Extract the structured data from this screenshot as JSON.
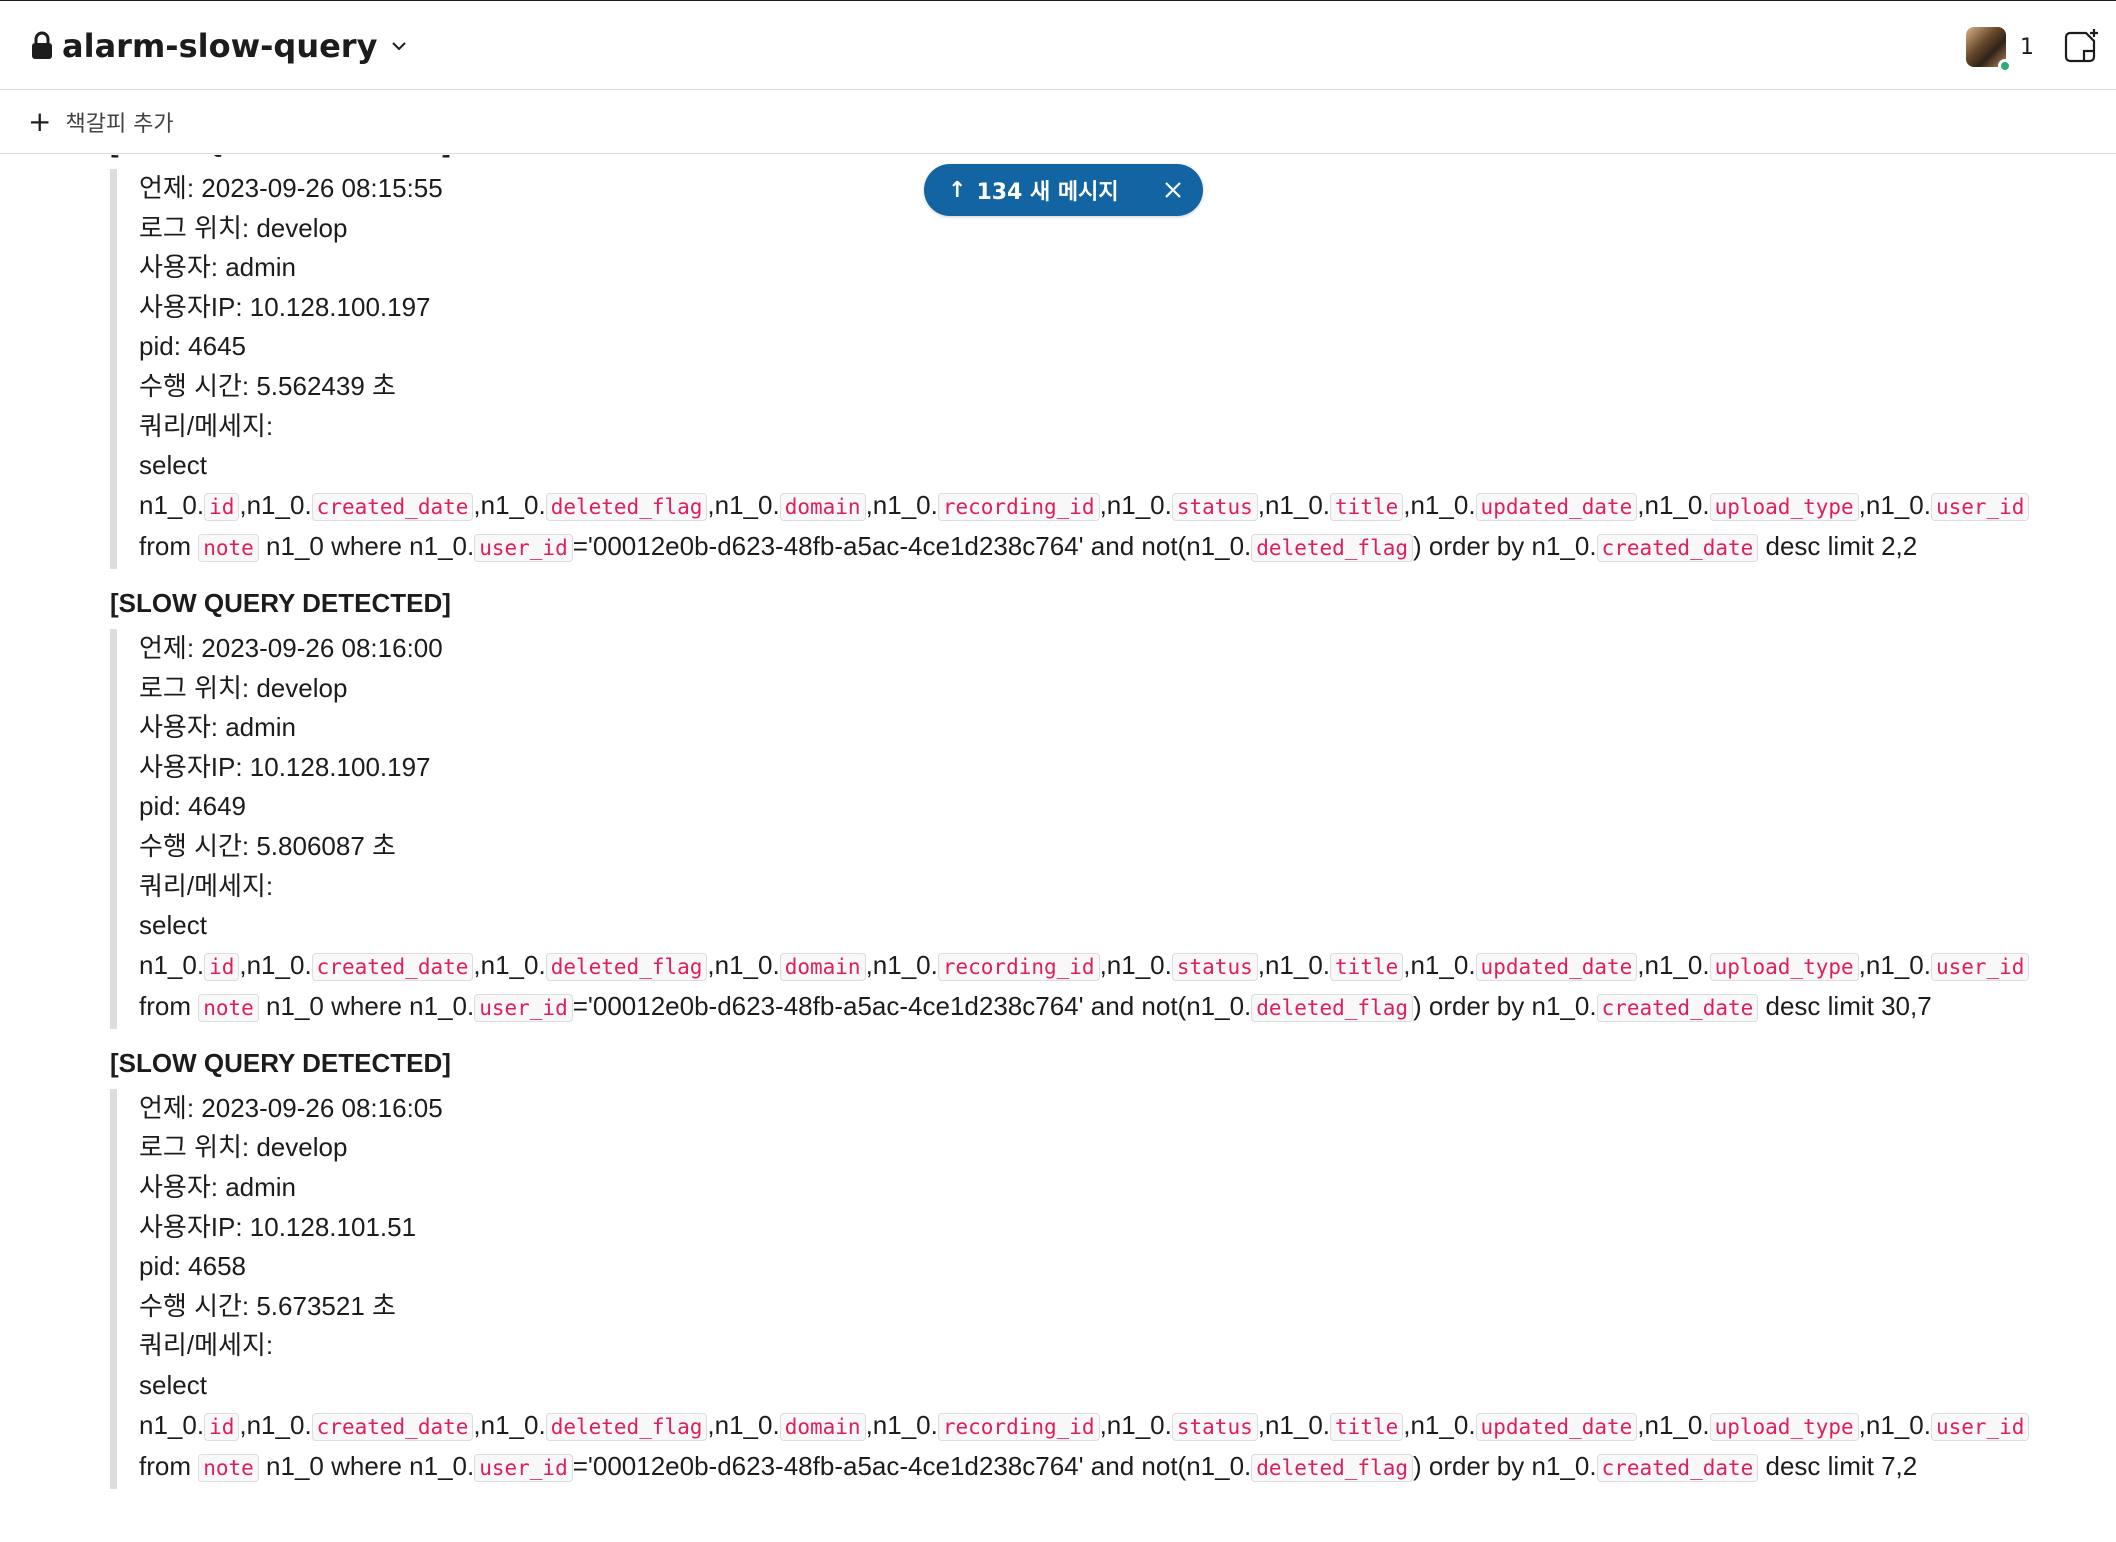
{
  "header": {
    "channel_name": "alarm-slow-query",
    "member_count": "1"
  },
  "bookmarks": {
    "add_label": "책갈피 추가"
  },
  "new_messages": {
    "label": "134 새 메시지"
  },
  "messages": [
    {
      "heading": "[SLOW QUERY DETECTED]",
      "when": "언제: 2023-09-26 08:15:55",
      "location": "로그 위치: develop",
      "user": "사용자: admin",
      "ip": "사용자IP: 10.128.100.197",
      "pid": "pid: 4645",
      "duration": "수행 시간: 5.562439 초",
      "query_label": "쿼리/메세지:",
      "select": "select",
      "limit": "desc limit 2,2"
    },
    {
      "heading": "[SLOW QUERY DETECTED]",
      "when": "언제: 2023-09-26 08:16:00",
      "location": "로그 위치: develop",
      "user": "사용자: admin",
      "ip": "사용자IP: 10.128.100.197",
      "pid": "pid: 4649",
      "duration": "수행 시간: 5.806087 초",
      "query_label": "쿼리/메세지:",
      "select": "select",
      "limit": "desc limit 30,7"
    },
    {
      "heading": "[SLOW QUERY DETECTED]",
      "when": "언제: 2023-09-26 08:16:05",
      "location": "로그 위치: develop",
      "user": "사용자: admin",
      "ip": "사용자IP: 10.128.101.51",
      "pid": "pid: 4658",
      "duration": "수행 시간: 5.673521 초",
      "query_label": "쿼리/메세지:",
      "select": "select",
      "limit": "desc limit 7,2"
    }
  ],
  "query": {
    "alias": "n1_0.",
    "sep_alias": ",n1_0.",
    "cols": {
      "id": "id",
      "created_date": "created_date",
      "deleted_flag": "deleted_flag",
      "domain": "domain",
      "recording_id": "recording_id",
      "status": "status",
      "title": "title",
      "updated_date": "updated_date",
      "upload_type": "upload_type",
      "user_id": "user_id",
      "note": "note"
    },
    "from": "from",
    "where": "n1_0 where n1_0.",
    "uuid_clause": "='00012e0b-d623-48fb-a5ac-4ce1d238c764' and not(n1_0.",
    "order_by": ") order by n1_0."
  }
}
